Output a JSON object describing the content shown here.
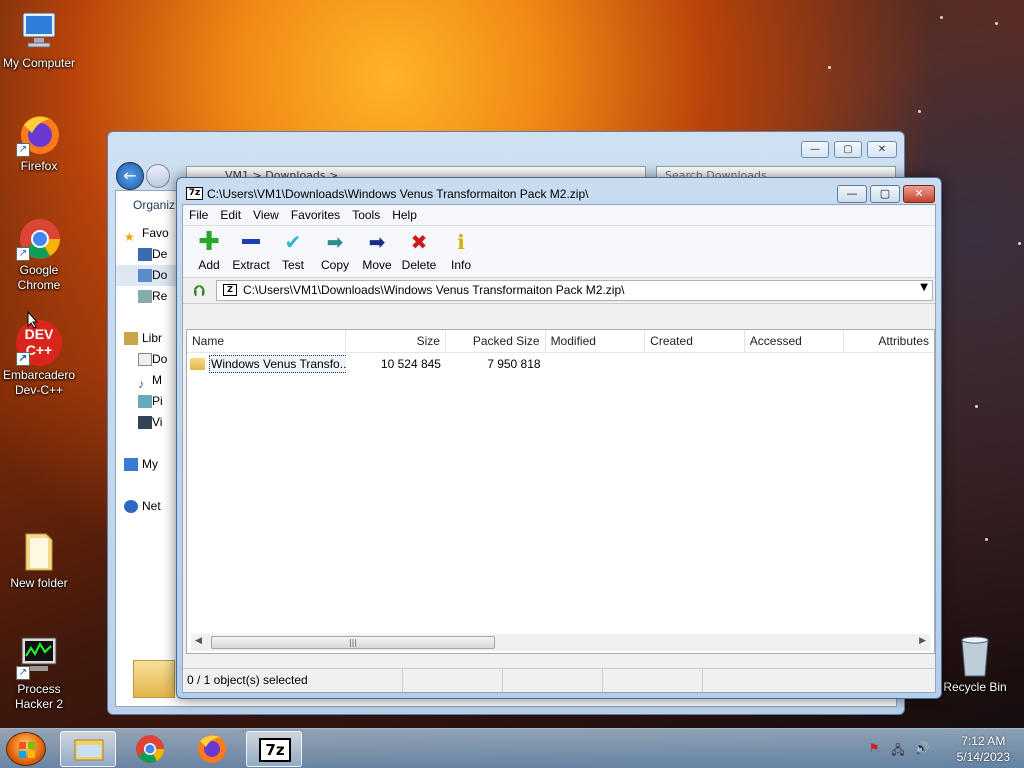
{
  "desktop": {
    "icons": [
      {
        "label": "My Computer"
      },
      {
        "label": "Firefox"
      },
      {
        "label": "Google Chrome"
      },
      {
        "label": "Embarcadero Dev-C++",
        "badge": "DEV C++"
      },
      {
        "label": "New folder"
      },
      {
        "label": "Process Hacker 2"
      },
      {
        "label": "Recycle Bin"
      }
    ]
  },
  "explorer_bg": {
    "organize": "Organiz",
    "nav_items": [
      "Favo",
      "De",
      "Do",
      "Re",
      "Libr",
      "Do",
      "M",
      "Pi",
      "Vi",
      "My",
      "Net"
    ],
    "address_partial": "VM1 > Downloads >",
    "search_placeholder": "Search Downloads"
  },
  "zip": {
    "logo": "7z",
    "title": "C:\\Users\\VM1\\Downloads\\Windows Venus Transformaiton Pack M2.zip\\",
    "menu": [
      "File",
      "Edit",
      "View",
      "Favorites",
      "Tools",
      "Help"
    ],
    "toolbar": [
      {
        "label": "Add",
        "icon": "plus-icon",
        "color": "#2aa52a"
      },
      {
        "label": "Extract",
        "icon": "minus-icon",
        "color": "#1a3fb5"
      },
      {
        "label": "Test",
        "icon": "check-icon",
        "color": "#2ab8c8"
      },
      {
        "label": "Copy",
        "icon": "double-arrow-icon",
        "color": "#2a8f8a"
      },
      {
        "label": "Move",
        "icon": "arrow-right-icon",
        "color": "#1a2f8a"
      },
      {
        "label": "Delete",
        "icon": "x-icon",
        "color": "#d01818"
      },
      {
        "label": "Info",
        "icon": "info-icon",
        "color": "#d4b000"
      }
    ],
    "address": "C:\\Users\\VM1\\Downloads\\Windows Venus Transformaiton Pack M2.zip\\",
    "columns": [
      "Name",
      "Size",
      "Packed Size",
      "Modified",
      "Created",
      "Accessed",
      "Attributes"
    ],
    "rows": [
      {
        "name": "Windows Venus Transfo...",
        "size": "10 524 845",
        "packed": "7 950 818",
        "modified": "",
        "created": "",
        "accessed": "",
        "attributes": ""
      }
    ],
    "status": "0 / 1 object(s) selected"
  },
  "taskbar": {
    "time": "7:12 AM",
    "date": "5/14/2023",
    "active_app": "7z"
  }
}
